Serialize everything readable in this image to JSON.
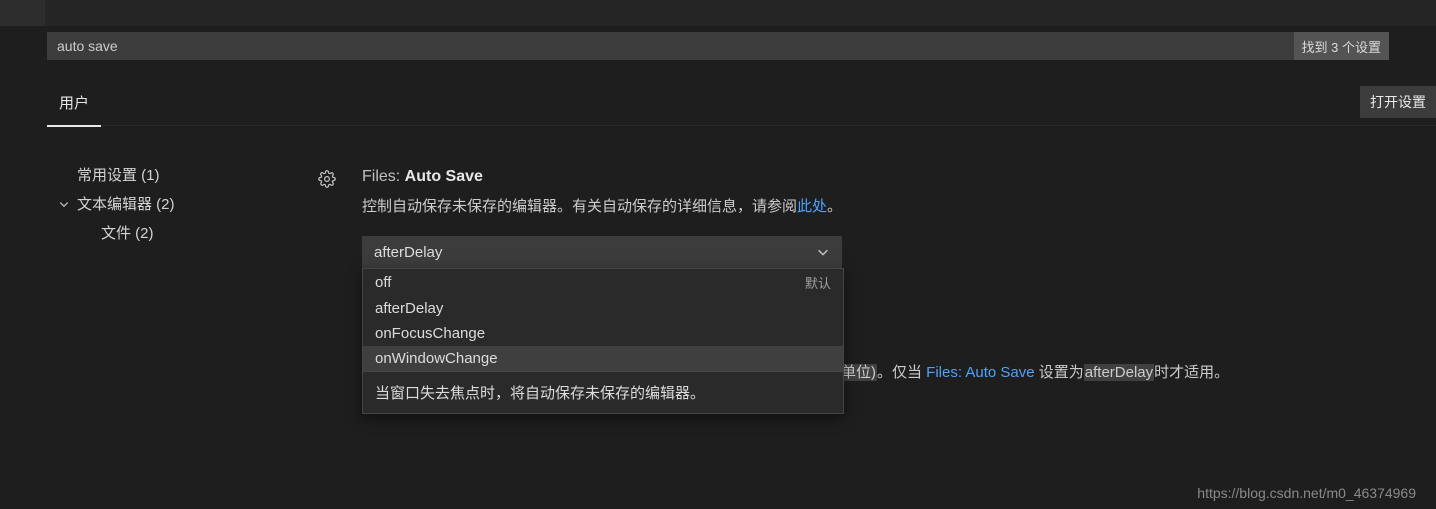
{
  "search": {
    "query": "auto save",
    "result_label": "找到 3 个设置"
  },
  "tabs": {
    "user": "用户",
    "open_settings": "打开设置"
  },
  "toc": [
    {
      "label": "常用设置 (1)"
    },
    {
      "label": "文本编辑器 (2)"
    },
    {
      "label": "文件 (2)"
    }
  ],
  "setting1": {
    "category": "Files: ",
    "name": "Auto Save",
    "desc_part1": "控制自动保存未保存的编辑器。有关自动保存的详细信息，请参阅",
    "link_text": "此处",
    "desc_part2": "。",
    "selected": "afterDelay",
    "default_badge": "默认",
    "options": [
      {
        "label": "off",
        "is_default": true
      },
      {
        "label": "afterDelay"
      },
      {
        "label": "onFocusChange"
      },
      {
        "label": "onWindowChange"
      }
    ],
    "option_tip": "当窗口失去焦点时，将自动保存未保存的编辑器。"
  },
  "setting2": {
    "unit_fragment": "单位)",
    "mid1": "。仅当 ",
    "link_text": "Files: Auto Save",
    "mid2": " 设置为",
    "after_delay": "afterDelay",
    "tail": "时才适用。"
  },
  "watermark": "https://blog.csdn.net/m0_46374969"
}
